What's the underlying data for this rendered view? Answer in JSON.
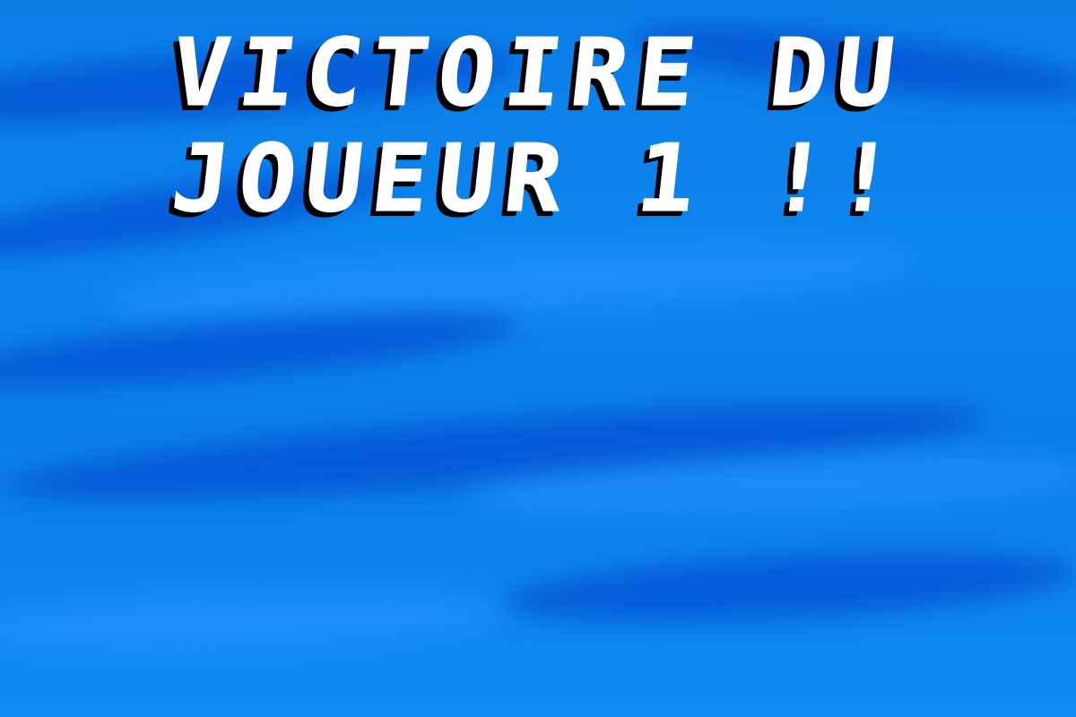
{
  "screen": {
    "name": "victory-screen",
    "background_color": "#0a7fe8",
    "title_color": "#ffffff",
    "title_shadow_color": "#000000"
  },
  "title": {
    "line1": "VICTOIRE DU",
    "line2": "JOUEUR 1 !!"
  }
}
